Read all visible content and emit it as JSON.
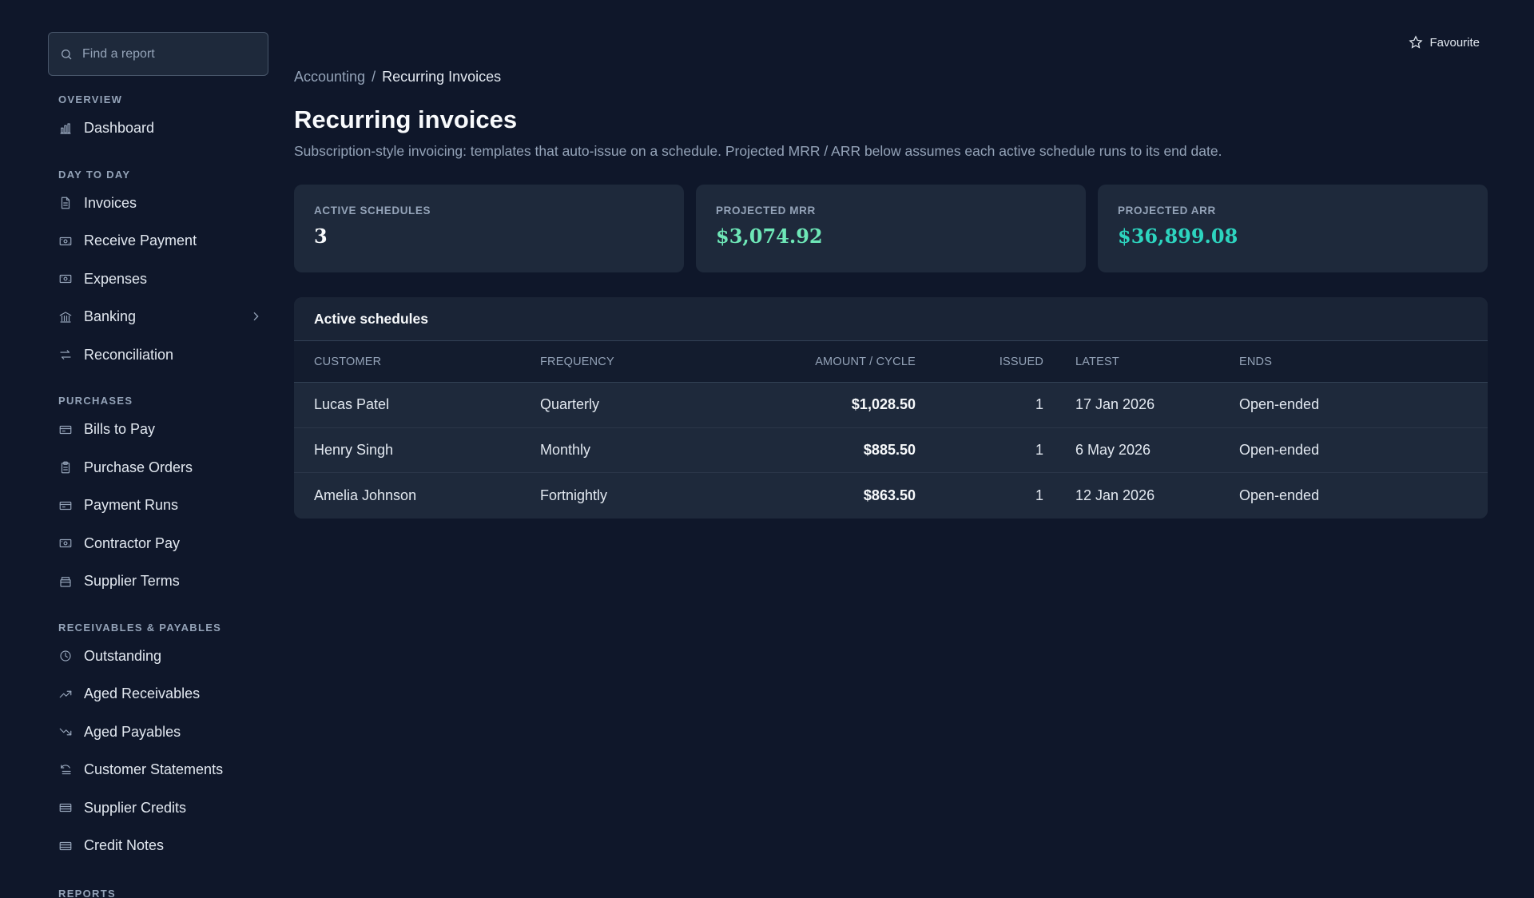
{
  "search": {
    "placeholder": "Find a report"
  },
  "favourite": "Favourite",
  "sidebar": {
    "sections": [
      {
        "label": "OVERVIEW",
        "items": [
          {
            "label": "Dashboard",
            "icon": "bar-chart-icon"
          }
        ]
      },
      {
        "label": "DAY TO DAY",
        "items": [
          {
            "label": "Invoices",
            "icon": "document-icon"
          },
          {
            "label": "Receive Payment",
            "icon": "cash-icon"
          },
          {
            "label": "Expenses",
            "icon": "cash-icon"
          },
          {
            "label": "Banking",
            "icon": "bank-icon",
            "has_submenu": true
          },
          {
            "label": "Reconciliation",
            "icon": "arrows-icon"
          }
        ]
      },
      {
        "label": "PURCHASES",
        "items": [
          {
            "label": "Bills to Pay",
            "icon": "card-icon"
          },
          {
            "label": "Purchase Orders",
            "icon": "clipboard-icon"
          },
          {
            "label": "Payment Runs",
            "icon": "card-icon"
          },
          {
            "label": "Contractor Pay",
            "icon": "cash-icon"
          },
          {
            "label": "Supplier Terms",
            "icon": "archive-icon"
          }
        ]
      },
      {
        "label": "RECEIVABLES & PAYABLES",
        "items": [
          {
            "label": "Outstanding",
            "icon": "clock-icon"
          },
          {
            "label": "Aged Receivables",
            "icon": "trend-up-icon"
          },
          {
            "label": "Aged Payables",
            "icon": "trend-down-icon"
          },
          {
            "label": "Customer Statements",
            "icon": "statement-icon"
          },
          {
            "label": "Supplier Credits",
            "icon": "list-icon"
          },
          {
            "label": "Credit Notes",
            "icon": "list-icon"
          }
        ]
      },
      {
        "label": "REPORTS",
        "items": []
      }
    ]
  },
  "breadcrumb": {
    "parent": "Accounting",
    "separator": "/",
    "current": "Recurring Invoices"
  },
  "page": {
    "title": "Recurring invoices",
    "subtitle": "Subscription-style invoicing: templates that auto-issue on a schedule. Projected MRR / ARR below assumes each active schedule runs to its end date."
  },
  "stats": [
    {
      "label": "ACTIVE SCHEDULES",
      "value": "3",
      "color": "#f8fafc"
    },
    {
      "label": "PROJECTED MRR",
      "value": "$3,074.92",
      "color": "#6ee7b7"
    },
    {
      "label": "PROJECTED ARR",
      "value": "$36,899.08",
      "color": "#2dd4bf"
    }
  ],
  "table": {
    "title": "Active schedules",
    "columns": [
      "CUSTOMER",
      "FREQUENCY",
      "AMOUNT / CYCLE",
      "ISSUED",
      "LATEST",
      "ENDS"
    ],
    "rows": [
      [
        "Lucas Patel",
        "Quarterly",
        "$1,028.50",
        "1",
        "17 Jan 2026",
        "Open-ended"
      ],
      [
        "Henry Singh",
        "Monthly",
        "$885.50",
        "1",
        "6 May 2026",
        "Open-ended"
      ],
      [
        "Amelia Johnson",
        "Fortnightly",
        "$863.50",
        "1",
        "12 Jan 2026",
        "Open-ended"
      ]
    ]
  }
}
